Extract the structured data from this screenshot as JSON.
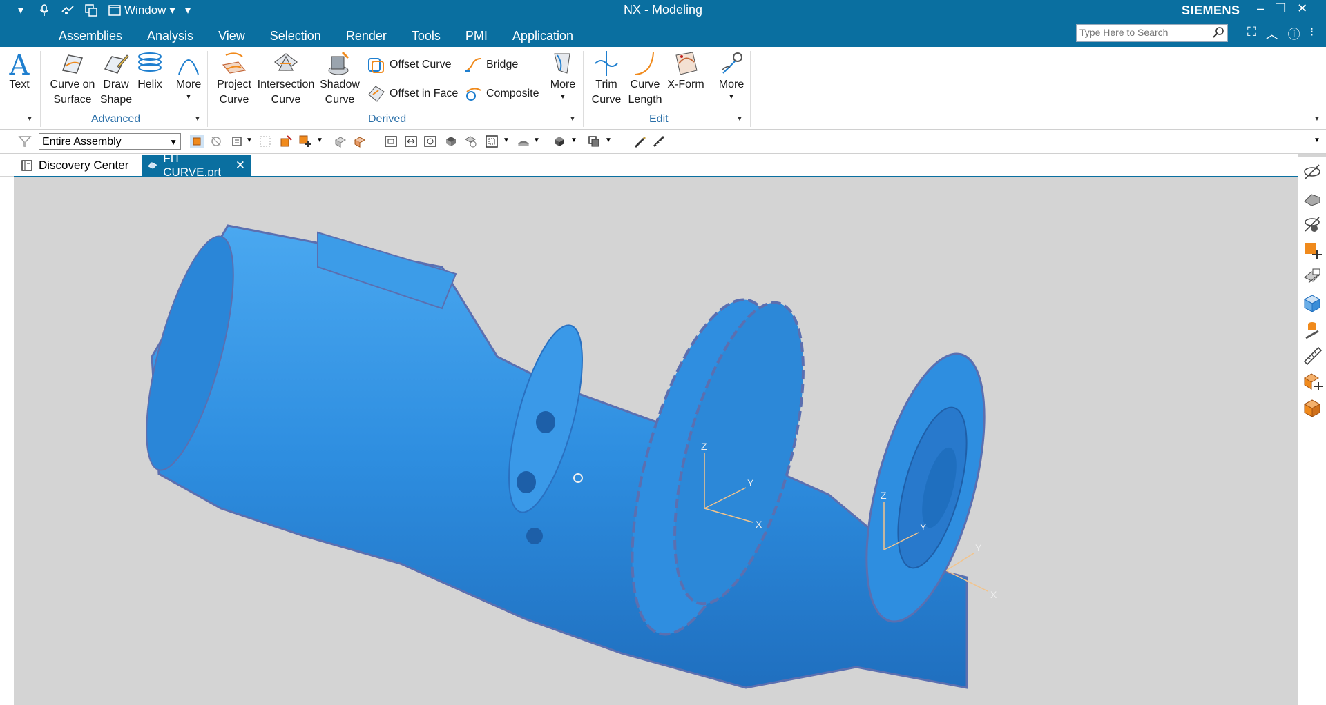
{
  "window": {
    "title": "NX - Modeling",
    "brand": "SIEMENS",
    "quick_access": {
      "window_label": "Window"
    }
  },
  "menu": [
    "Assemblies",
    "Analysis",
    "View",
    "Selection",
    "Render",
    "Tools",
    "PMI",
    "Application"
  ],
  "search": {
    "placeholder": "Type Here to Search"
  },
  "ribbon": {
    "text": {
      "label": "Text"
    },
    "advanced": {
      "label": "Advanced",
      "curve_on_surface": [
        "Curve on",
        "Surface"
      ],
      "draw_shape": [
        "Draw",
        "Shape"
      ],
      "helix": "Helix",
      "more": "More"
    },
    "derived": {
      "label": "Derived",
      "project_curve": [
        "Project",
        "Curve"
      ],
      "intersection_curve": [
        "Intersection",
        "Curve"
      ],
      "shadow_curve": [
        "Shadow",
        "Curve"
      ],
      "offset_curve": "Offset Curve",
      "offset_in_face": "Offset in Face",
      "bridge": "Bridge",
      "composite": "Composite",
      "more": "More"
    },
    "edit": {
      "label": "Edit",
      "trim_curve": [
        "Trim",
        "Curve"
      ],
      "curve_length": [
        "Curve",
        "Length"
      ],
      "x_form": "X-Form",
      "more": "More"
    }
  },
  "selection_bar": {
    "scope": "Entire Assembly"
  },
  "tabs": [
    {
      "label": "Discovery Center"
    },
    {
      "label": "FIT CURVE.prt"
    }
  ],
  "viewport": {
    "axis_labels": {
      "z": "Z",
      "y": "Y",
      "x": "X"
    },
    "model_color": "#2e8ee0"
  },
  "colors": {
    "titlebar": "#0a6fa0",
    "group_label": "#2a6fa8",
    "model": "#2e8ee0",
    "accent_orange": "#f08a1c"
  }
}
